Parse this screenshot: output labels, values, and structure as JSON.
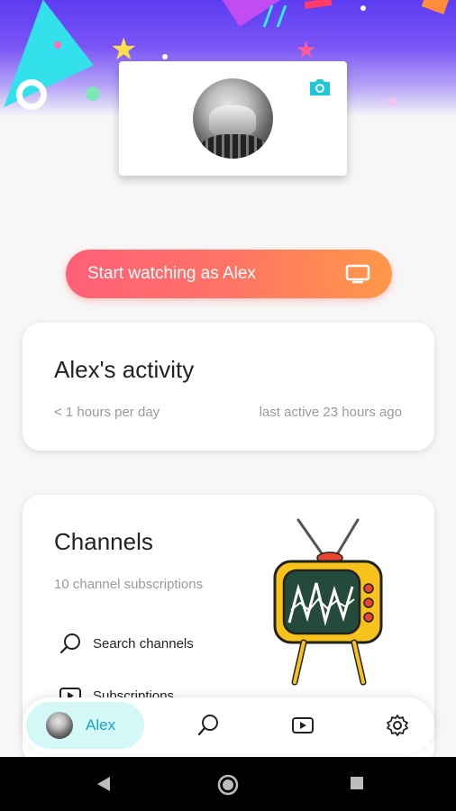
{
  "profile": {
    "name": "Alex",
    "camera_icon": "camera-icon"
  },
  "watch_button": {
    "label": "Start watching as Alex",
    "icon": "tv-icon"
  },
  "activity": {
    "title": "Alex's activity",
    "usage": "< 1 hours per day",
    "last_active": "last active 23 hours ago"
  },
  "channels": {
    "title": "Channels",
    "subscriptions_count": "10 channel subscriptions",
    "items": [
      {
        "label": "Search channels",
        "icon": "search-icon"
      },
      {
        "label": "Subscriptions",
        "icon": "video-icon"
      }
    ]
  },
  "bottom_nav": {
    "profile_label": "Alex",
    "items": [
      "search-icon",
      "video-icon",
      "settings-icon"
    ],
    "active_bg": "#d4f7f7",
    "active_text": "#18a6c4"
  },
  "colors": {
    "accent_cyan": "#1ec8d6",
    "button_gradient_start": "#ff5f78",
    "button_gradient_end": "#ff9848"
  },
  "system_nav": [
    "back-icon",
    "home-icon",
    "recents-icon"
  ]
}
